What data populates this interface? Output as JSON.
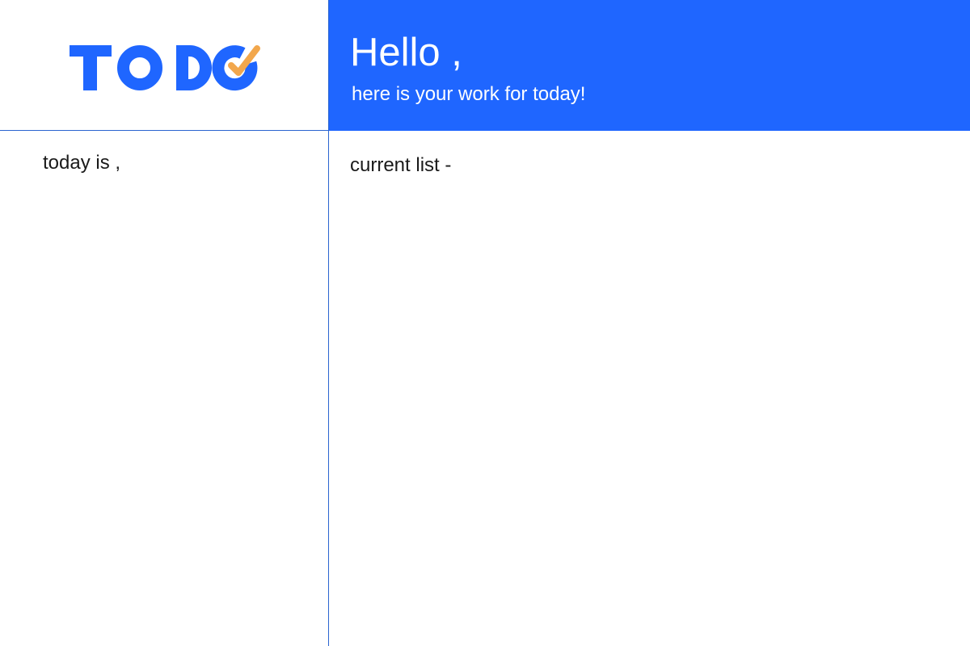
{
  "app": {
    "logo_text": "TODO"
  },
  "header": {
    "greeting": "Hello ,",
    "subtitle": "here is your work for today!"
  },
  "sidebar": {
    "date_label": "today is ,"
  },
  "main": {
    "list_heading": "current list -"
  },
  "colors": {
    "brand_blue": "#1f66ff",
    "accent_orange": "#f2a74c",
    "divider": "#2a64cf"
  }
}
